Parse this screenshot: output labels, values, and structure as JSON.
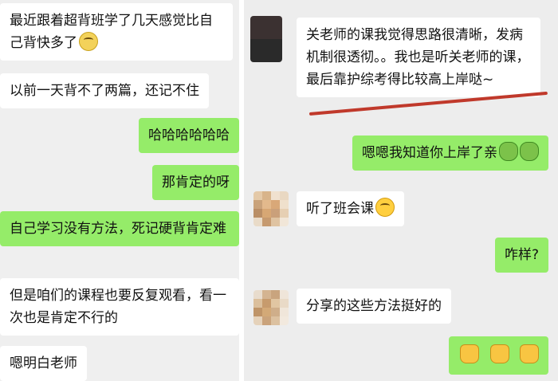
{
  "left_chat": {
    "messages": [
      {
        "side": "in",
        "text": "最近跟着超背班学了几天感觉比自己背快多了",
        "emoji": "sweat-smile-emoji"
      },
      {
        "side": "in",
        "text": "以前一天背不了两篇，还记不住"
      },
      {
        "side": "out",
        "text": "哈哈哈哈哈哈"
      },
      {
        "side": "out",
        "text": "那肯定的呀"
      },
      {
        "side": "out",
        "text": "自己学习没有方法，死记硬背肯定难"
      },
      {
        "side": "in",
        "text": "但是咱们的课程也要反复观看，看一次也是肯定不行的"
      },
      {
        "side": "in",
        "text": "嗯明白老师"
      }
    ]
  },
  "right_chat": {
    "messages": [
      {
        "side": "in",
        "text": "关老师的课我觉得思路很清晰，发病机制很透彻。。我也是听关老师的课，最后靠护综考得比较高上岸哒~"
      },
      {
        "side": "out",
        "text": "嗯嗯我知道你上岸了亲",
        "emoji": "sprout-emoji"
      },
      {
        "side": "in",
        "text": "听了班会课",
        "emoji": "flushed-emoji"
      },
      {
        "side": "out",
        "text": "咋样?"
      },
      {
        "side": "in",
        "text": "分享的这些方法挺好的"
      },
      {
        "side": "out",
        "text": "",
        "emoji": "fist-emoji"
      }
    ]
  },
  "colors": {
    "incoming_bubble": "#ffffff",
    "outgoing_bubble": "#95ec69",
    "background": "#ededed",
    "annotation_line": "#c0392b"
  }
}
